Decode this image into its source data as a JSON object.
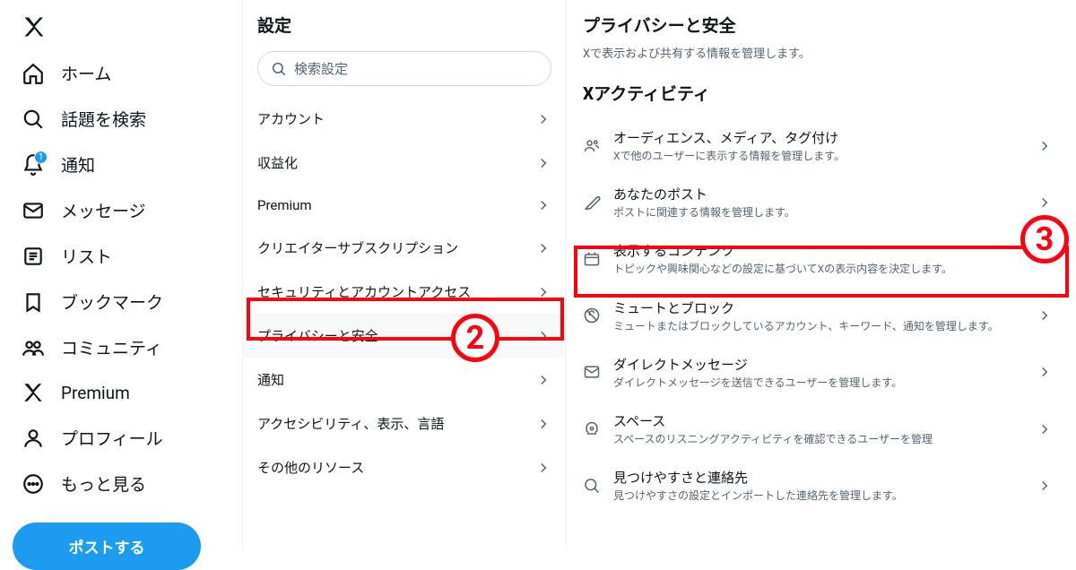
{
  "nav": {
    "items": [
      {
        "label": "ホーム",
        "icon": "home-icon"
      },
      {
        "label": "話題を検索",
        "icon": "search-icon"
      },
      {
        "label": "通知",
        "icon": "bell-icon",
        "badge": "1"
      },
      {
        "label": "メッセージ",
        "icon": "mail-icon"
      },
      {
        "label": "リスト",
        "icon": "list-icon"
      },
      {
        "label": "ブックマーク",
        "icon": "bookmark-icon"
      },
      {
        "label": "コミュニティ",
        "icon": "community-icon"
      },
      {
        "label": "Premium",
        "icon": "x-icon"
      },
      {
        "label": "プロフィール",
        "icon": "profile-icon"
      },
      {
        "label": "もっと見る",
        "icon": "more-icon"
      }
    ],
    "post_button": "ポストする"
  },
  "settings": {
    "title": "設定",
    "search_placeholder": "検索設定",
    "items": [
      "アカウント",
      "収益化",
      "Premium",
      "クリエイターサブスクリプション",
      "セキュリティとアカウントアクセス",
      "プライバシーと安全",
      "通知",
      "アクセシビリティ、表示、言語",
      "その他のリソース"
    ],
    "active_index": 5
  },
  "detail": {
    "title": "プライバシーと安全",
    "subtitle": "Xで表示および共有する情報を管理します。",
    "section": "Xアクティビティ",
    "items": [
      {
        "label": "オーディエンス、メディア、タグ付け",
        "desc": "Xで他のユーザーに表示する情報を管理します。"
      },
      {
        "label": "あなたのポスト",
        "desc": "ポストに関連する情報を管理します。"
      },
      {
        "label": "表示するコンテンツ",
        "desc": "トピックや興味関心などの設定に基づいてXの表示内容を決定します。"
      },
      {
        "label": "ミュートとブロック",
        "desc": "ミュートまたはブロックしているアカウント、キーワード、通知を管理します。"
      },
      {
        "label": "ダイレクトメッセージ",
        "desc": "ダイレクトメッセージを送信できるユーザーを管理します。"
      },
      {
        "label": "スペース",
        "desc": "スペースのリスニングアクティビティを確認できるユーザーを管理"
      },
      {
        "label": "見つけやすさと連絡先",
        "desc": "見つけやすさの設定とインポートした連絡先を管理します。"
      }
    ]
  },
  "annotations": {
    "n2": "2",
    "n3": "3"
  }
}
